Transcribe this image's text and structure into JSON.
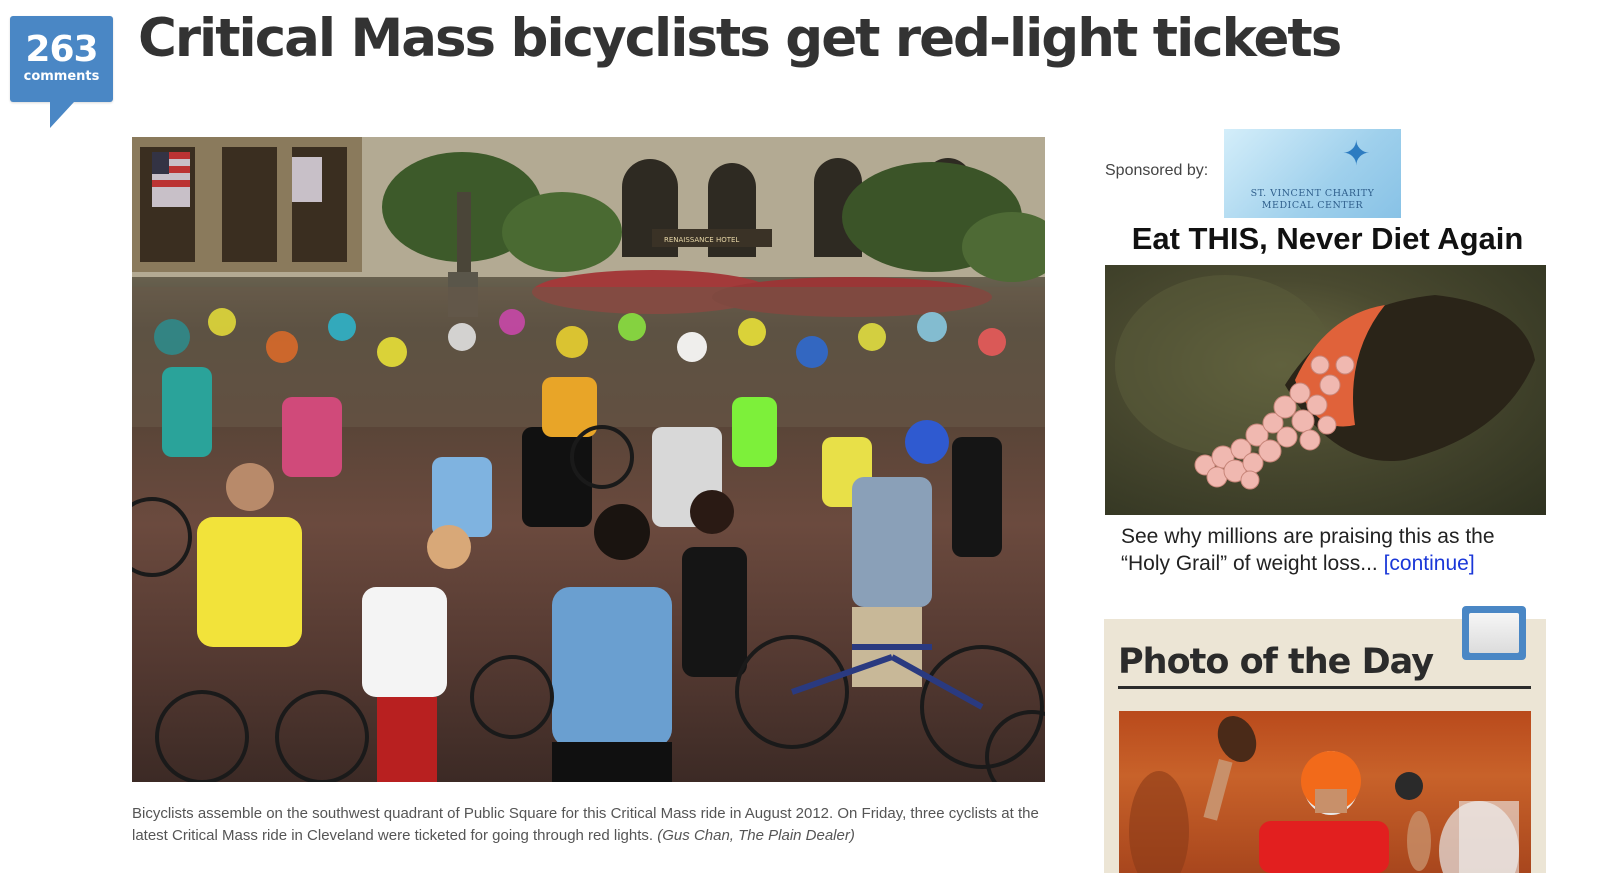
{
  "article": {
    "comments": {
      "count": "263",
      "label": "comments"
    },
    "headline": "Critical Mass bicyclists get red-light tickets",
    "caption": {
      "text": "Bicyclists assemble on the southwest quadrant of Public Square for this Critical Mass ride in August 2012. On Friday, three cyclists at the latest Critical Mass ride in Cleveland were ticketed for going through red lights.",
      "credit": "(Gus Chan, The Plain Dealer)"
    },
    "photo_sign": "RENAISSANCE HOTEL"
  },
  "sidebar": {
    "sponsor": {
      "label": "Sponsored by:",
      "logo_line1": "ST. VINCENT CHARITY",
      "logo_line2": "MEDICAL CENTER"
    },
    "ad": {
      "headline": "Eat THIS, Never Diet Again",
      "body": "See why millions are praising this as the “Holy Grail” of weight loss...",
      "link": "[continue]"
    },
    "photo_of_the_day": {
      "title": "Photo of the Day"
    }
  },
  "colors": {
    "comment_bubble": "#4a87c5",
    "headline": "#333333",
    "ad_link": "#1a37d8",
    "potd_background": "#ece5d5"
  }
}
